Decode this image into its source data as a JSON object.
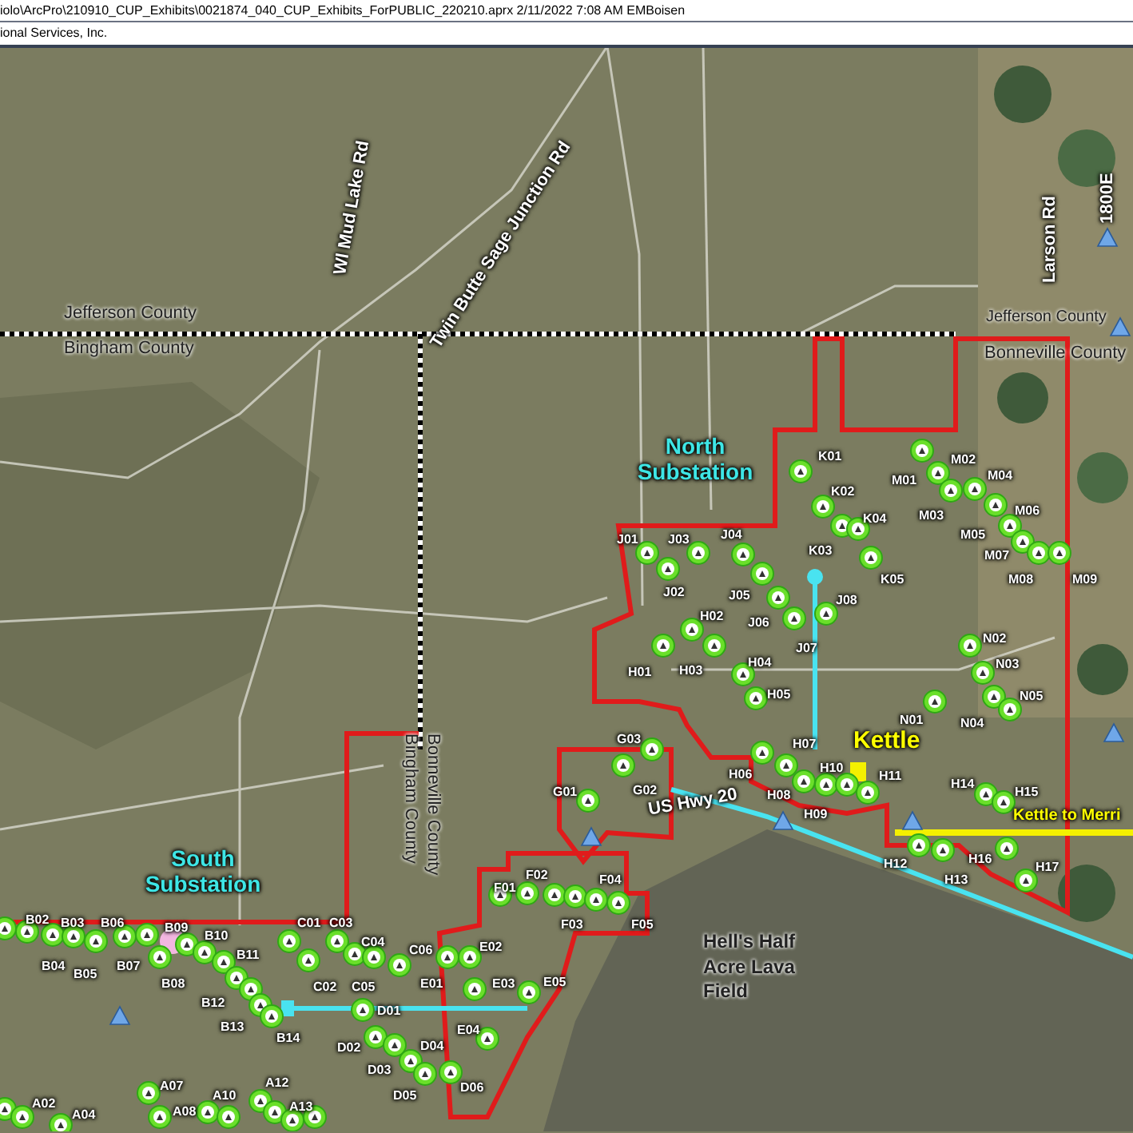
{
  "header": {
    "file_path": "iolo\\ArcPro\\210910_CUP_Exhibits\\0021874_040_CUP_Exhibits_ForPUBLIC_220210.aprx  2/11/2022  7:08 AM EMBoisen",
    "company": "ional Services, Inc."
  },
  "map": {
    "road_labels": [
      {
        "text": "Wl Mud Lake Rd"
      },
      {
        "text": "Twin Butte Sage Junction Rd"
      },
      {
        "text": "Larson Rd"
      },
      {
        "text": "1800E"
      },
      {
        "text": "US Hwy 20"
      }
    ],
    "county_labels": [
      {
        "text": "Jefferson County"
      },
      {
        "text": "Bingham County"
      },
      {
        "text": "Jefferson County"
      },
      {
        "text": "Bonneville County"
      },
      {
        "text": "Bingham County"
      },
      {
        "text": "Bonneville County"
      }
    ],
    "substations": [
      {
        "text": "North Substation"
      },
      {
        "text": "South Substation"
      },
      {
        "text": "Kettle"
      }
    ],
    "line_labels": [
      {
        "text": "Kettle to Merri"
      }
    ],
    "area_labels": [
      {
        "text": "Hell's Half Acre Lava Field"
      }
    ],
    "turbines": [
      "K01",
      "K02",
      "K03",
      "K04",
      "K05",
      "M01",
      "M02",
      "M03",
      "M04",
      "M05",
      "M06",
      "M07",
      "M08",
      "M09",
      "J01",
      "J02",
      "J03",
      "J04",
      "J05",
      "J06",
      "J07",
      "J08",
      "H01",
      "H02",
      "H03",
      "H04",
      "H05",
      "N01",
      "N02",
      "N03",
      "N04",
      "N05",
      "G01",
      "G02",
      "G03",
      "H06",
      "H07",
      "H08",
      "H09",
      "H10",
      "H11",
      "H12",
      "H13",
      "H14",
      "H15",
      "H16",
      "H17",
      "F01",
      "F02",
      "F03",
      "F04",
      "F05",
      "B02",
      "B03",
      "B04",
      "B05",
      "B06",
      "B07",
      "B09",
      "B08",
      "B10",
      "B11",
      "B12",
      "B13",
      "B14",
      "C01",
      "C02",
      "C03",
      "C04",
      "C05",
      "C06",
      "E01",
      "E02",
      "E03",
      "E04",
      "E05",
      "D01",
      "D02",
      "D03",
      "D04",
      "D05",
      "D06",
      "A02",
      "A04",
      "A07",
      "A08",
      "A10",
      "A12",
      "A13"
    ]
  }
}
